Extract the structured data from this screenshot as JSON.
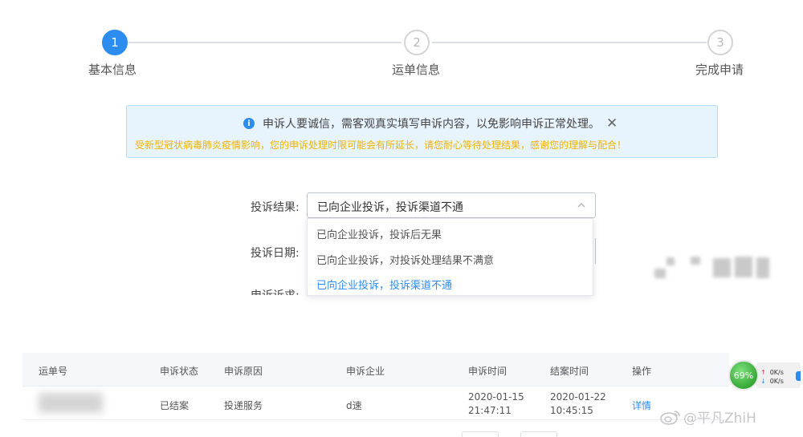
{
  "steps": [
    {
      "number": "1",
      "label": "基本信息"
    },
    {
      "number": "2",
      "label": "运单信息"
    },
    {
      "number": "3",
      "label": "完成申请"
    }
  ],
  "notice": {
    "main": "申诉人要诚信，需客观真实填写申诉内容，以免影响申诉正常处理。",
    "sub": "受新型冠状病毒肺炎疫情影响，您的申诉处理时限可能会有所延长，请您耐心等待处理结果，感谢您的理解与配合！"
  },
  "form": {
    "result_label": "投诉结果:",
    "result_value": "已向企业投诉，投诉渠道不通",
    "date_label": "投诉日期:",
    "cut_label": "申诉诉求:",
    "options": [
      "已向企业投诉，投诉后无果",
      "已向企业投诉，对投诉处理结果不满意",
      "已向企业投诉，投诉渠道不通"
    ]
  },
  "table": {
    "headers": [
      "运单号",
      "申诉状态",
      "申诉原因",
      "申诉企业",
      "申诉时间",
      "结案时间",
      "操作"
    ],
    "row": {
      "status": "已结案",
      "reason": "投递服务",
      "company": "d速",
      "appeal_date": "2020-01-15",
      "appeal_time": "21:47:11",
      "close_date": "2020-01-22",
      "close_time": "10:45:15",
      "action": "详情"
    }
  },
  "widget": {
    "percent": "69%",
    "up": "0K/s",
    "down": "0K/s"
  },
  "watermark": "@平凡ZhiH",
  "colors": {
    "accent": "#2d8cf0",
    "warning": "#f0b400",
    "gauge": "#36a836"
  }
}
